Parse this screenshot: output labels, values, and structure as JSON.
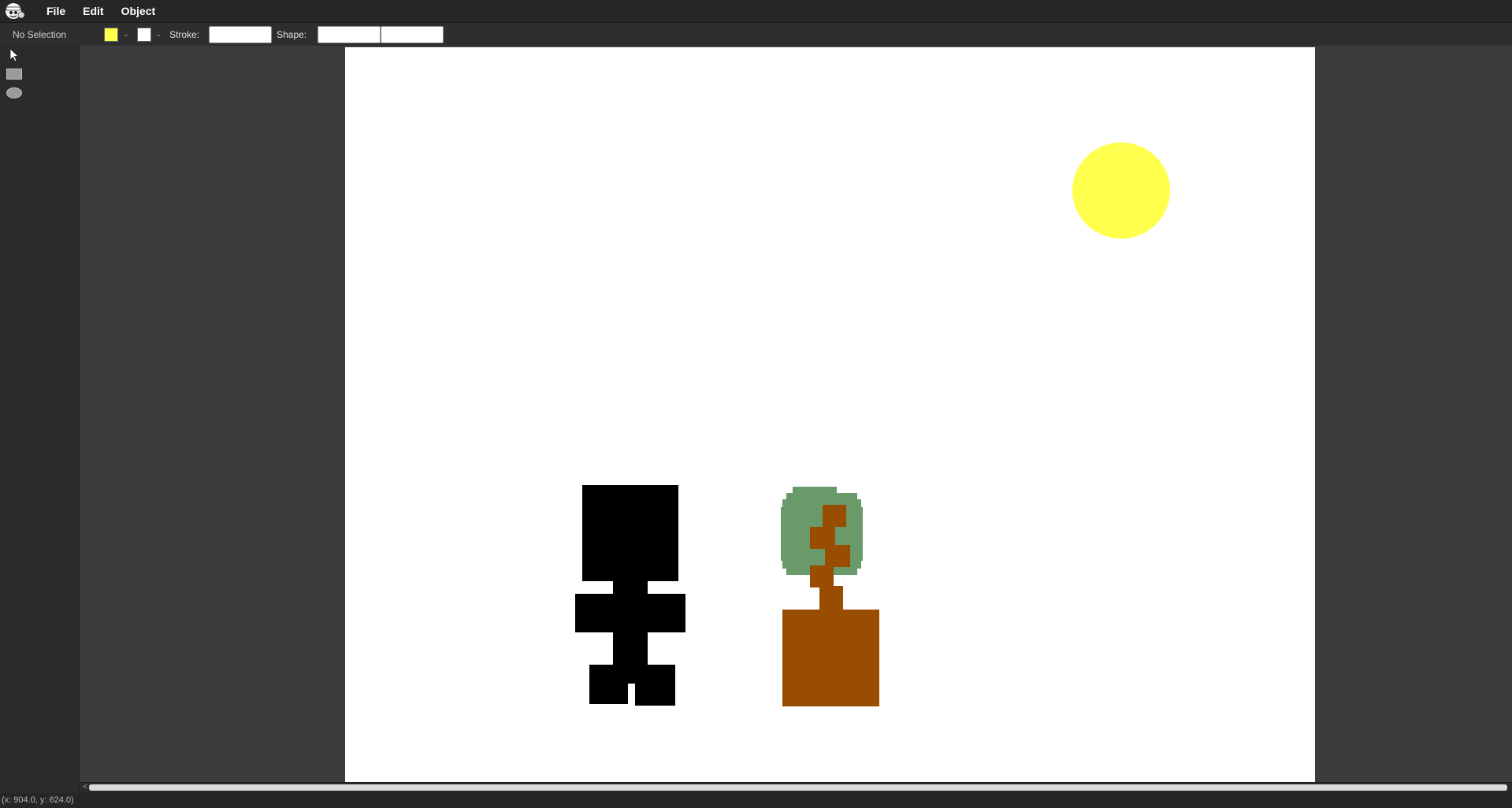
{
  "menubar": {
    "logo_icon": "app-logo-face-icon",
    "items": [
      "File",
      "Edit",
      "Object"
    ]
  },
  "propbar": {
    "selection_status": "No Selection",
    "fill_color": "#ffff4d",
    "stroke_color": "#ffffff",
    "dropdown_glyph": "⌄",
    "stroke_label": "Stroke:",
    "stroke_value": "",
    "shape_label": "Shape:",
    "shape_value_1": "",
    "shape_value_2": ""
  },
  "tools": [
    {
      "name": "select-tool",
      "icon": "arrow-pointer-icon"
    },
    {
      "name": "rectangle-tool",
      "icon": "rectangle-icon"
    },
    {
      "name": "ellipse-tool",
      "icon": "ellipse-icon"
    }
  ],
  "artboard": {
    "background": "#ffffff",
    "shapes": [
      {
        "label": "sun",
        "kind": "ellipse",
        "fill": "#ffff4d"
      },
      {
        "label": "person-figure",
        "kind": "rect-group",
        "fill": "#000000"
      },
      {
        "label": "tree-foliage",
        "kind": "pixel-group",
        "fill": "#6a9a6a"
      },
      {
        "label": "tree-trunk",
        "kind": "rect-group",
        "fill": "#994d00"
      },
      {
        "label": "planter-box",
        "kind": "rect",
        "fill": "#994d00"
      }
    ]
  },
  "scrollbar": {
    "left_arrow": "<"
  },
  "statusbar": {
    "coordinates": "(x: 904.0, y: 624.0)"
  }
}
